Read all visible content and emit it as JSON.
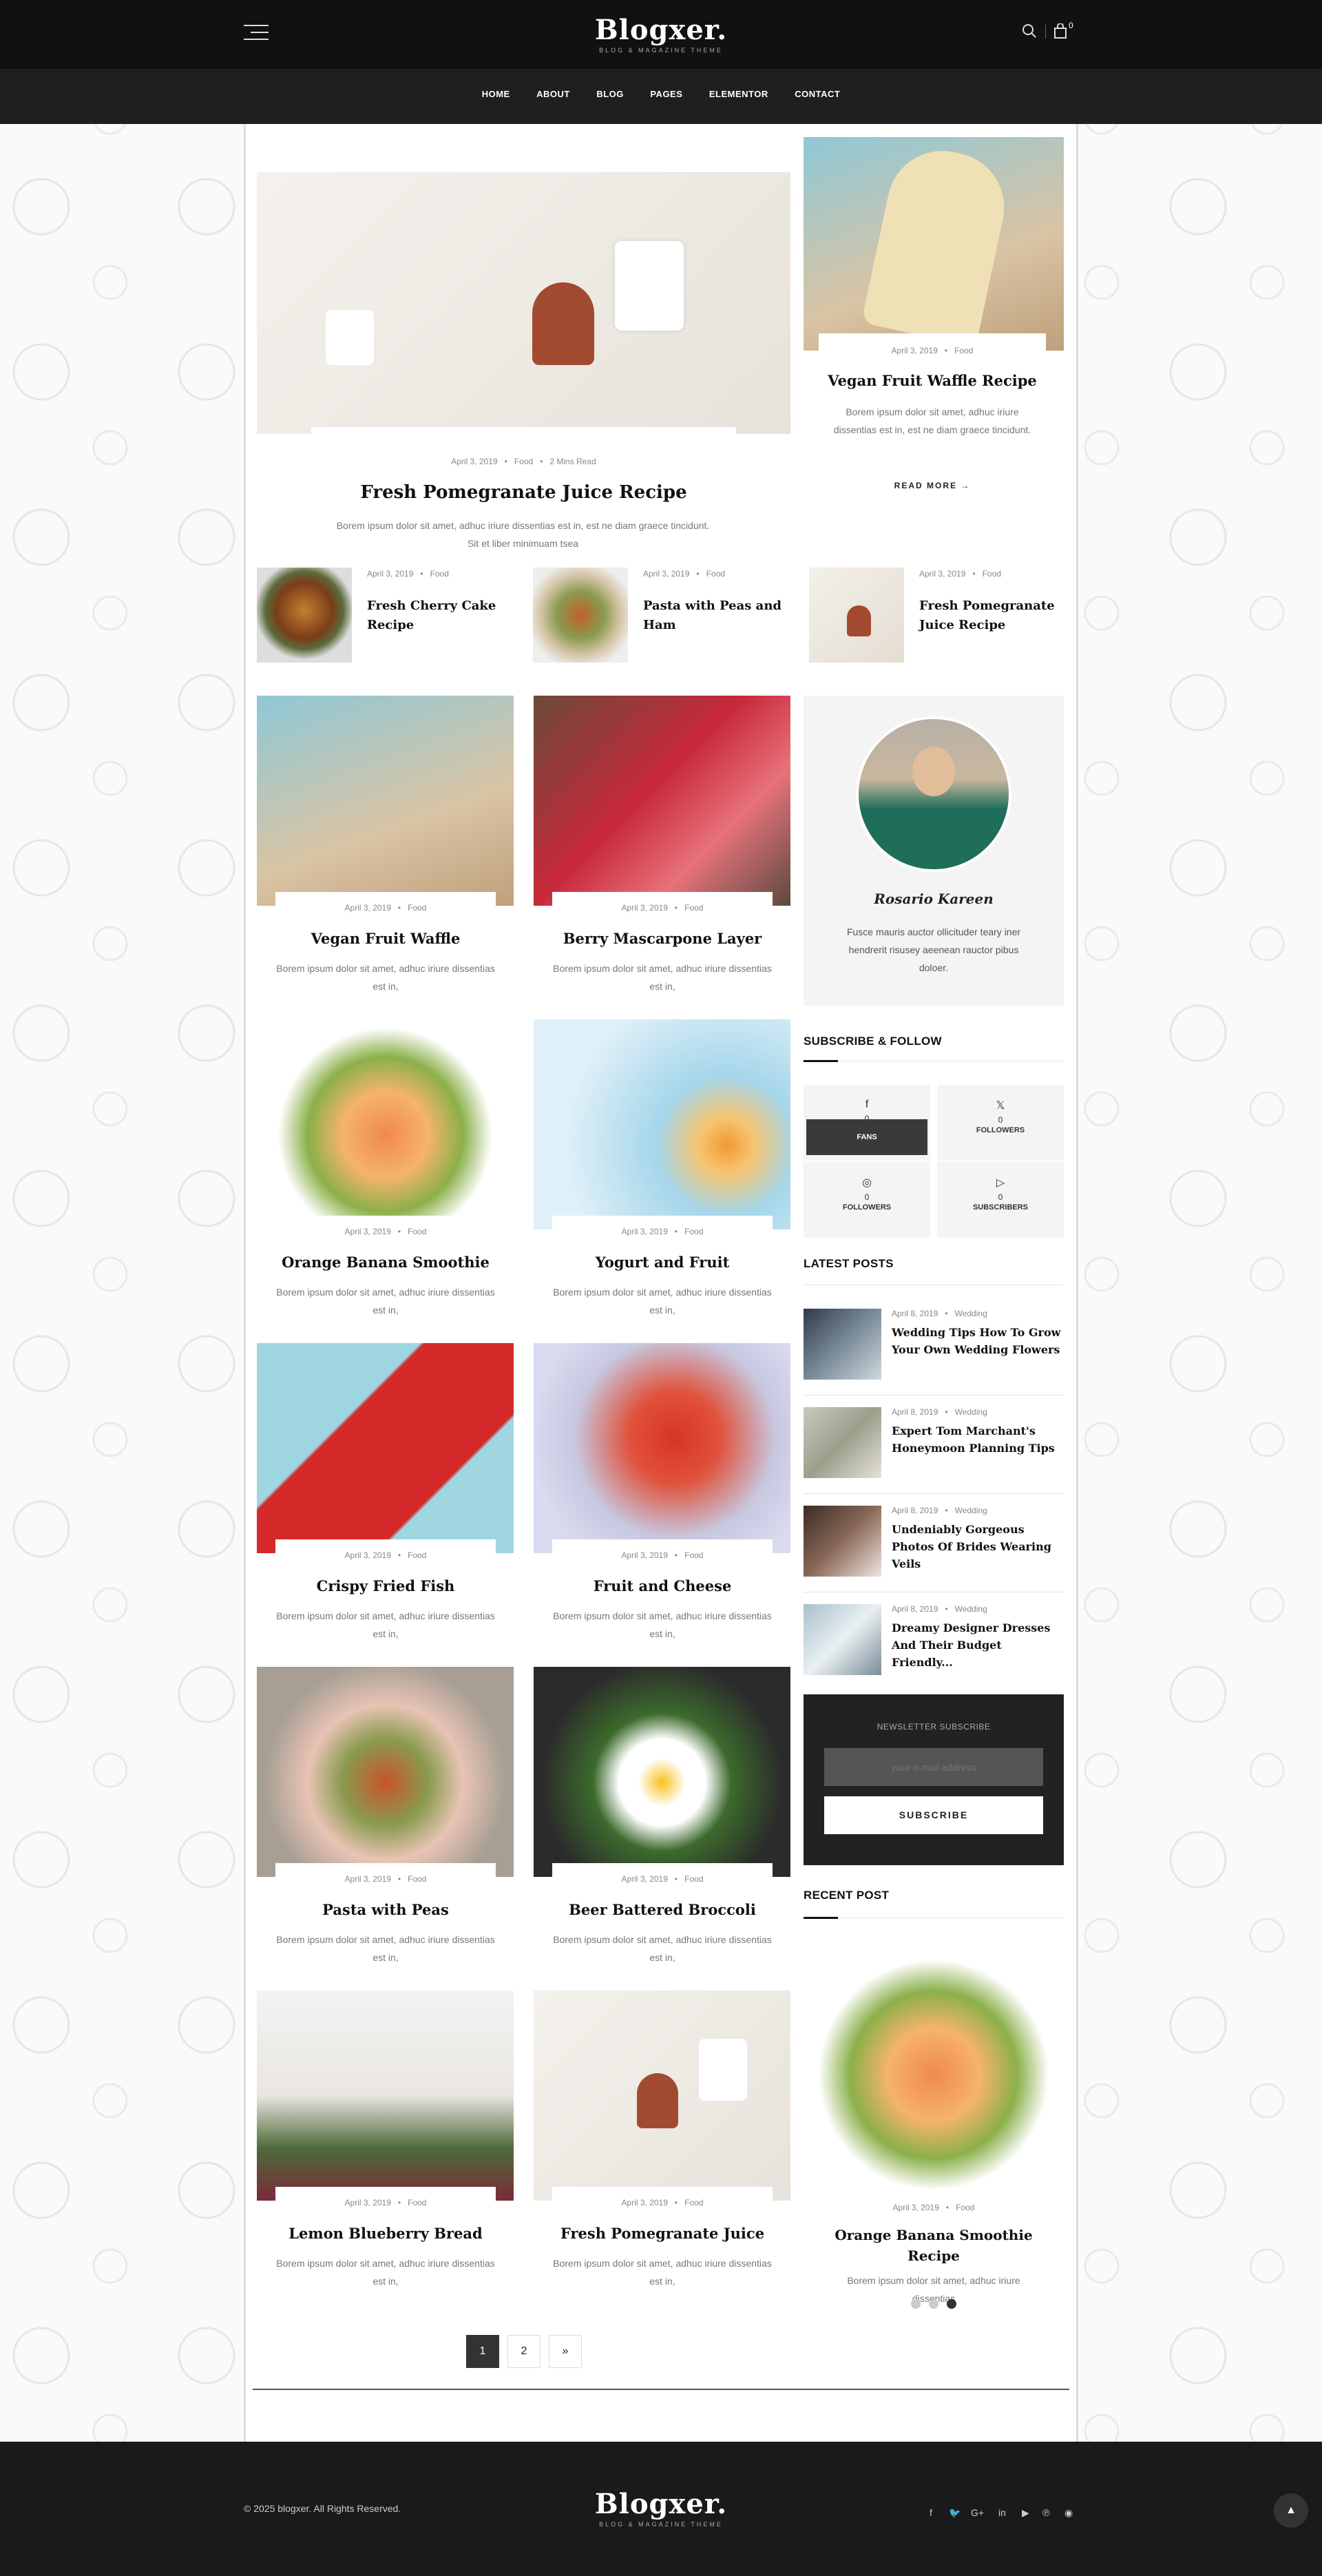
{
  "header": {
    "logo": "Blogxer.",
    "tagline": "BLOG & MAGAZINE THEME",
    "cart_count": "0",
    "menu": [
      "HOME",
      "ABOUT",
      "BLOG",
      "PAGES",
      "ELEMENTOR",
      "CONTACT"
    ]
  },
  "hero": {
    "date": "April 3, 2019",
    "category": "Food",
    "read": "2 Mins Read",
    "title": "Fresh Pomegranate Juice Recipe",
    "excerpt": "Borem ipsum dolor sit amet, adhuc iriure dissentias est in, est ne diam graece tincidunt. Sit et liber minimuam tsea"
  },
  "feature_right": {
    "date": "April 3, 2019",
    "category": "Food",
    "title": "Vegan Fruit Waffle Recipe",
    "excerpt": "Borem ipsum dolor sit amet, adhuc iriure dissentias est in, est ne diam graece tincidunt.",
    "read_more": "READ MORE"
  },
  "small_posts": [
    {
      "date": "April 3, 2019",
      "category": "Food",
      "title": "Fresh Cherry Cake Recipe"
    },
    {
      "date": "April 3, 2019",
      "category": "Food",
      "title": "Pasta with Peas and Ham"
    },
    {
      "date": "April 3, 2019",
      "category": "Food",
      "title": "Fresh Pomegranate Juice Recipe"
    }
  ],
  "grid_posts": [
    {
      "date": "April 3, 2019",
      "category": "Food",
      "title": "Vegan Fruit Waffle",
      "excerpt": "Borem ipsum dolor sit amet, adhuc iriure dissentias est in,"
    },
    {
      "date": "April 3, 2019",
      "category": "Food",
      "title": "Berry Mascarpone Layer",
      "excerpt": "Borem ipsum dolor sit amet, adhuc iriure dissentias est in,"
    },
    {
      "date": "April 3, 2019",
      "category": "Food",
      "title": "Orange Banana Smoothie",
      "excerpt": "Borem ipsum dolor sit amet, adhuc iriure dissentias est in,"
    },
    {
      "date": "April 3, 2019",
      "category": "Food",
      "title": "Yogurt and Fruit",
      "excerpt": "Borem ipsum dolor sit amet, adhuc iriure dissentias est in,"
    },
    {
      "date": "April 3, 2019",
      "category": "Food",
      "title": "Crispy Fried Fish",
      "excerpt": "Borem ipsum dolor sit amet, adhuc iriure dissentias est in,"
    },
    {
      "date": "April 3, 2019",
      "category": "Food",
      "title": "Fruit and Cheese",
      "excerpt": "Borem ipsum dolor sit amet, adhuc iriure dissentias est in,"
    },
    {
      "date": "April 3, 2019",
      "category": "Food",
      "title": "Pasta with Peas",
      "excerpt": "Borem ipsum dolor sit amet, adhuc iriure dissentias est in,"
    },
    {
      "date": "April 3, 2019",
      "category": "Food",
      "title": "Beer Battered Broccoli",
      "excerpt": "Borem ipsum dolor sit amet, adhuc iriure dissentias est in,"
    },
    {
      "date": "April 3, 2019",
      "category": "Food",
      "title": "Lemon Blueberry Bread",
      "excerpt": "Borem ipsum dolor sit amet, adhuc iriure dissentias est in,"
    },
    {
      "date": "April 3, 2019",
      "category": "Food",
      "title": "Fresh Pomegranate Juice",
      "excerpt": "Borem ipsum dolor sit amet, adhuc iriure dissentias est in,"
    }
  ],
  "author": {
    "signature": "Rosario Kareen",
    "bio": "Fusce mauris auctor ollicituder teary iner hendrerit risusey aeenean rauctor pibus doloer."
  },
  "subscribe_follow": {
    "title": "SUBSCRIBE & FOLLOW",
    "items": [
      {
        "icon": "f",
        "count": "0",
        "label": "FANS"
      },
      {
        "icon": "𝕏",
        "count": "0",
        "label": "FOLLOWERS"
      },
      {
        "icon": "◎",
        "count": "0",
        "label": "FOLLOWERS"
      },
      {
        "icon": "▷",
        "count": "0",
        "label": "SUBSCRIBERS"
      }
    ]
  },
  "latest": {
    "title": "LATEST POSTS",
    "items": [
      {
        "date": "April 8, 2019",
        "category": "Wedding",
        "title": "Wedding Tips How To Grow Your Own Wedding Flowers"
      },
      {
        "date": "April 8, 2019",
        "category": "Wedding",
        "title": "Expert Tom Marchant's Honeymoon Planning Tips"
      },
      {
        "date": "April 8, 2019",
        "category": "Wedding",
        "title": "Undeniably Gorgeous Photos Of Brides Wearing Veils"
      },
      {
        "date": "April 8, 2019",
        "category": "Wedding",
        "title": "Dreamy Designer Dresses And Their Budget Friendly..."
      }
    ]
  },
  "newsletter": {
    "title": "NEWSLETTER SUBSCRIBE",
    "placeholder": "your e-mail address",
    "button": "SUBSCRIBE"
  },
  "recent": {
    "title": "RECENT POST",
    "date": "April 3, 2019",
    "category": "Food",
    "post_title": "Orange Banana Smoothie Recipe",
    "excerpt": "Borem ipsum dolor sit amet, adhuc iriure dissentias"
  },
  "pagination": [
    "1",
    "2",
    "»"
  ],
  "footer": {
    "copyright": "© 2025 blogxer. All Rights Reserved.",
    "logo": "Blogxer.",
    "tagline": "BLOG & MAGAZINE THEME",
    "social": [
      "f",
      "🐦",
      "G+",
      "in",
      "▶",
      "℗",
      "◉"
    ]
  },
  "colors": {
    "dark": "#111111",
    "nav": "#1f1f1f",
    "panel": "#f4f4f4",
    "newsletter": "#222222"
  }
}
